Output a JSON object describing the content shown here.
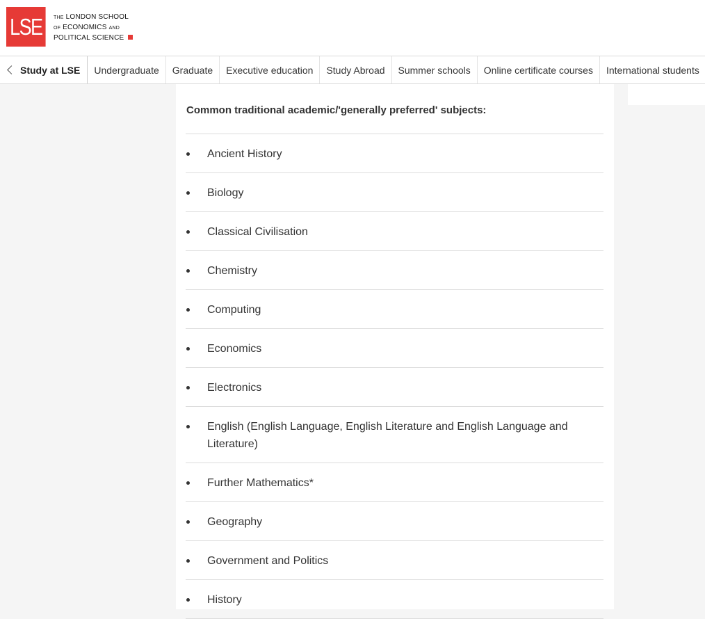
{
  "logo": {
    "mark": "LSE",
    "line1_prefix": "THE",
    "line1": "LONDON SCHOOL",
    "line2_prefix": "OF",
    "line2": "ECONOMICS",
    "line2_suffix": "AND",
    "line3": "POLITICAL SCIENCE",
    "accent_color": "#e63a36"
  },
  "nav": {
    "back_label": "Study at LSE",
    "items": [
      "Undergraduate",
      "Graduate",
      "Executive education",
      "Study Abroad",
      "Summer schools",
      "Online certificate courses",
      "International students"
    ]
  },
  "content": {
    "heading": "Common traditional academic/'generally preferred' subjects:",
    "subjects": [
      "Ancient History",
      "Biology",
      "Classical Civilisation",
      "Chemistry",
      "Computing",
      "Economics",
      "Electronics",
      "English (English Language, English Literature and English Language and Literature)",
      "Further Mathematics*",
      "Geography",
      "Government and Politics",
      "History"
    ]
  }
}
